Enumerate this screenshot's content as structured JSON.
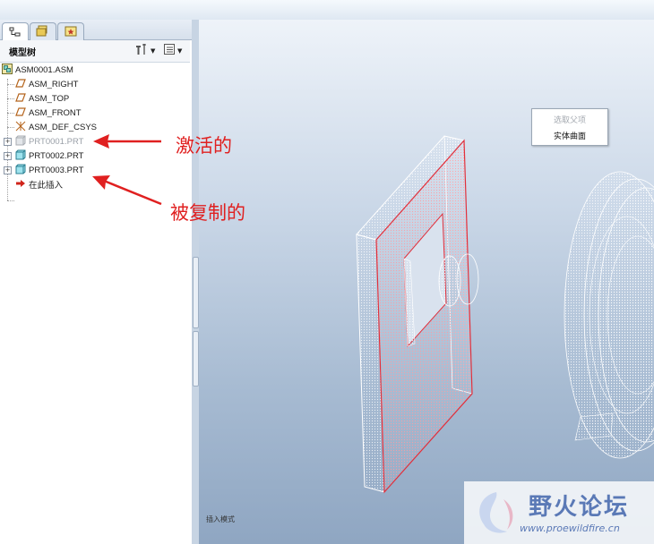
{
  "tree_panel": {
    "title": "模型树",
    "tabs": [
      {
        "icon": "model-tree-icon"
      },
      {
        "icon": "folder-browser-icon"
      },
      {
        "icon": "favorites-icon"
      }
    ],
    "header_buttons": [
      {
        "icon": "settings-icon"
      },
      {
        "icon": "show-options-icon"
      }
    ],
    "nodes": [
      {
        "label": "ASM0001.ASM",
        "icon": "assembly-icon"
      },
      {
        "label": "ASM_RIGHT",
        "icon": "datum-plane-icon"
      },
      {
        "label": "ASM_TOP",
        "icon": "datum-plane-icon"
      },
      {
        "label": "ASM_FRONT",
        "icon": "datum-plane-icon"
      },
      {
        "label": "ASM_DEF_CSYS",
        "icon": "coordinate-system-icon"
      },
      {
        "label": "PRT0001.PRT",
        "icon": "part-icon",
        "state": "dimmed"
      },
      {
        "label": "PRT0002.PRT",
        "icon": "part-icon"
      },
      {
        "label": "PRT0003.PRT",
        "icon": "part-icon"
      },
      {
        "label": "在此插入",
        "icon": "insert-here-arrow-icon"
      }
    ]
  },
  "context_menu": {
    "items": [
      {
        "label": "选取父项",
        "enabled": false
      },
      {
        "label": "实体曲面",
        "enabled": true
      }
    ]
  },
  "viewport": {
    "bottom_label": "插入模式"
  },
  "annotations": [
    {
      "text": "激活的",
      "color": "#e02020"
    },
    {
      "text": "被复制的",
      "color": "#e02020"
    }
  ],
  "watermark": {
    "text": "野火论坛",
    "url": "www.proewildfire.cn"
  }
}
